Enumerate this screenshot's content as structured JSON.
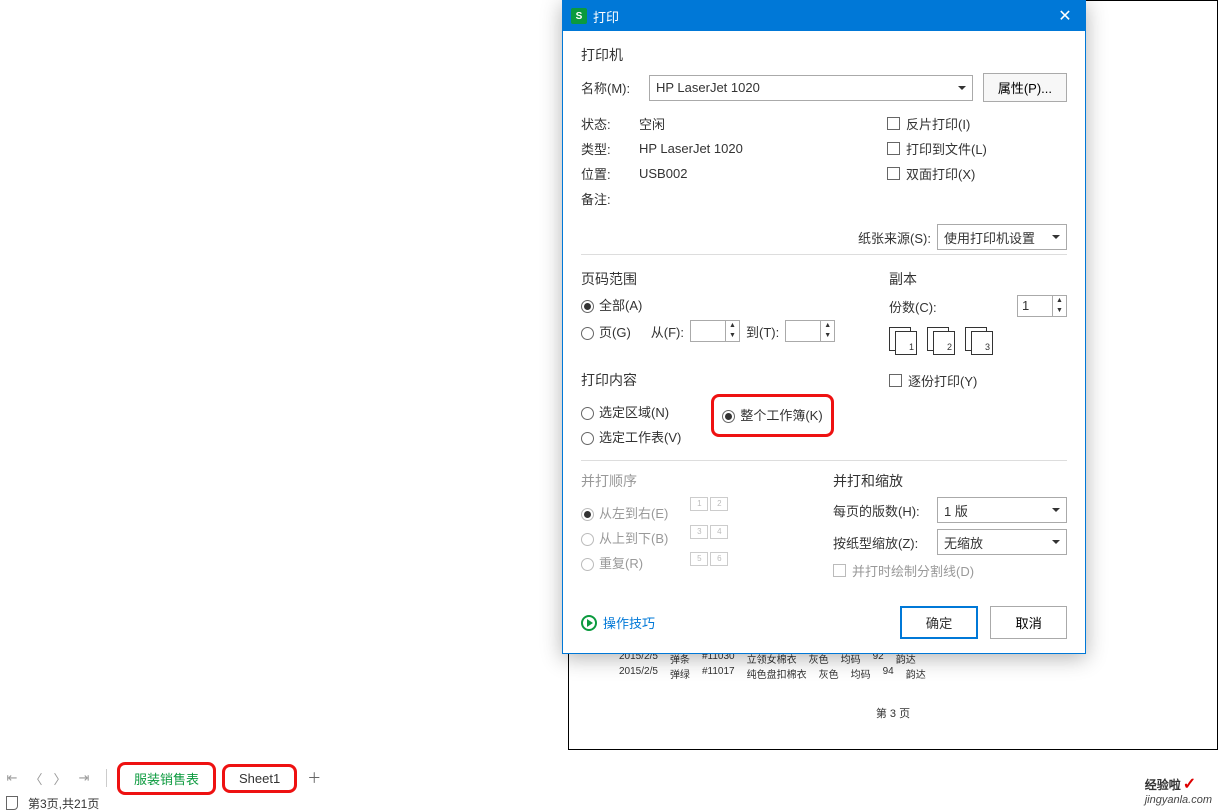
{
  "dialog": {
    "title": "打印",
    "printer_section": "打印机",
    "name_label": "名称(M):",
    "name_value": "HP LaserJet 1020",
    "props_btn": "属性(P)...",
    "status_label": "状态:",
    "status_value": "空闲",
    "type_label": "类型:",
    "type_value": "HP LaserJet 1020",
    "location_label": "位置:",
    "location_value": "USB002",
    "remark_label": "备注:",
    "reverse": "反片打印(I)",
    "to_file": "打印到文件(L)",
    "duplex": "双面打印(X)",
    "paper_src_label": "纸张来源(S):",
    "paper_src_value": "使用打印机设置",
    "range_title": "页码范围",
    "all": "全部(A)",
    "pages": "页(G)",
    "from": "从(F):",
    "to": "到(T):",
    "content_title": "打印内容",
    "sel_area": "选定区域(N)",
    "sel_sheet": "选定工作表(V)",
    "workbook": "整个工作簿(K)",
    "copies_title": "副本",
    "copies_label": "份数(C):",
    "copies_value": "1",
    "collate": "逐份打印(Y)",
    "seq_title": "并打顺序",
    "seq_lr": "从左到右(E)",
    "seq_tb": "从上到下(B)",
    "seq_repeat": "重复(R)",
    "scale_title": "并打和缩放",
    "per_page_label": "每页的版数(H):",
    "per_page_value": "1 版",
    "scale_label": "按纸型缩放(Z):",
    "scale_value": "无缩放",
    "draw_lines": "并打时绘制分割线(D)",
    "tips": "操作技巧",
    "ok": "确定",
    "cancel": "取消"
  },
  "preview": {
    "rows": [
      [
        "2015/2/5",
        "弹条",
        "#11030",
        "立领女棉衣",
        "灰色",
        "均码",
        "92",
        "韵达"
      ],
      [
        "2015/2/5",
        "弹绿",
        "#11017",
        "纯色盘扣棉衣",
        "灰色",
        "均码",
        "94",
        "韵达"
      ]
    ],
    "page": "第 3 页"
  },
  "tabs": {
    "t1": "服装销售表",
    "t2": "Sheet1"
  },
  "status": "第3页,共21页",
  "watermark": {
    "brand": "经验啦",
    "domain": "jingyanla.com"
  },
  "seq_nums": [
    "1",
    "2",
    "3",
    "4",
    "5",
    "6"
  ]
}
